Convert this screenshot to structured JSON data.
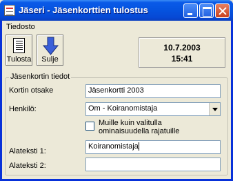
{
  "window": {
    "title": "Jäseri - Jäsenkorttien tulostus"
  },
  "menubar": {
    "items": [
      "Tiedosto"
    ]
  },
  "toolbar": {
    "print_label": "Tulosta",
    "close_label": "Sulje"
  },
  "datetime": {
    "date": "10.7.2003",
    "time": "15:41"
  },
  "group": {
    "title": "Jäsenkortin tiedot",
    "fields": {
      "card_title_label": "Kortin otsake",
      "card_title_value": "Jäsenkortti 2003",
      "person_label": "Henkilö:",
      "person_value": "Om - Koiranomistaja",
      "restrict_label_line1": "Muille kuin valitulla",
      "restrict_label_line2": "ominaisuudella rajatuille",
      "restrict_checked": false,
      "subtext1_label": "Alateksti 1:",
      "subtext1_value": "Koiranomistaja",
      "subtext2_label": "Alateksti 2:",
      "subtext2_value": ""
    }
  },
  "colors": {
    "title_bar": "#0553df",
    "window_bg": "#ece9d8",
    "field_border": "#7f9db9"
  },
  "icons": {
    "app": "window-app-icon",
    "print": "document-icon",
    "close": "down-arrow-icon"
  }
}
